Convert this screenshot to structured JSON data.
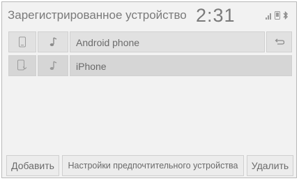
{
  "header": {
    "title": "Зарегистрированное устройство",
    "clock": "2:31",
    "status_icons": [
      "signal-icon",
      "phone-icon",
      "bluetooth-icon"
    ]
  },
  "devices": [
    {
      "name": "Android phone",
      "icon": "phone-icon",
      "audio_icon": "music-note-icon",
      "selected": false
    },
    {
      "name": "iPhone",
      "icon": "phone-connected-icon",
      "audio_icon": "music-note-icon",
      "selected": true
    }
  ],
  "toolbar": {
    "add_label": "Добавить",
    "preferences_label": "Настройки предпочтительного устройства",
    "delete_label": "Удалить"
  },
  "colors": {
    "background": "#f2f2f2",
    "cell": "#e1e1e1",
    "text": "#6a6a6a"
  }
}
